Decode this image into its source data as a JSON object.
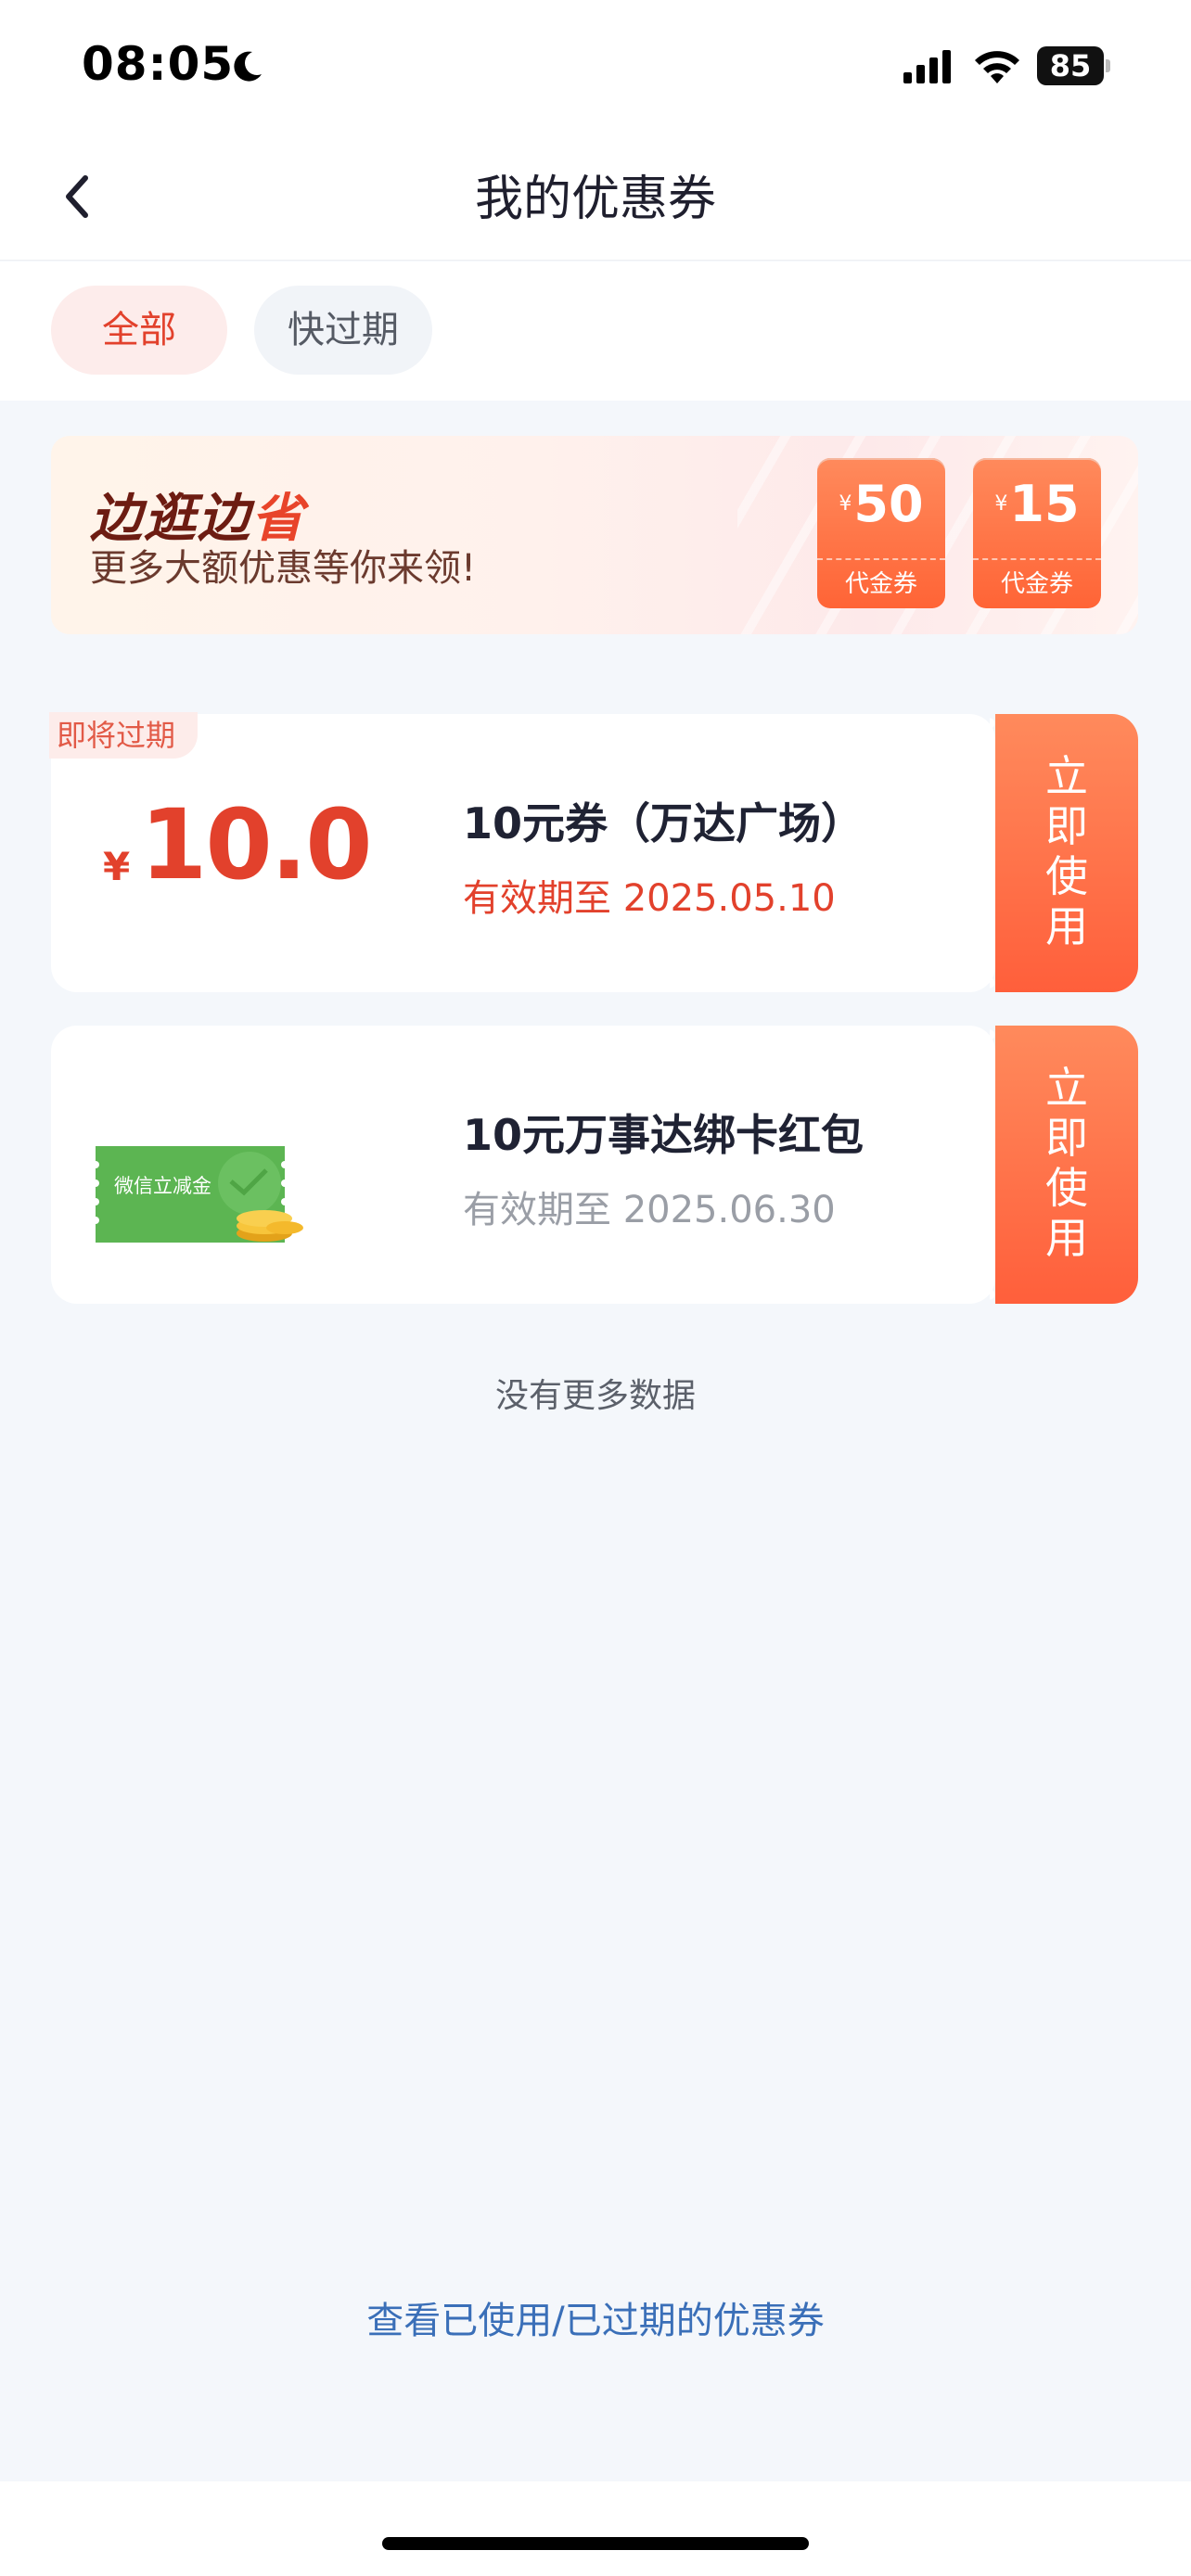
{
  "status_bar": {
    "time": "08:05",
    "battery": "85"
  },
  "nav": {
    "title": "我的优惠券"
  },
  "filters": [
    {
      "label": "全部",
      "active": true
    },
    {
      "label": "快过期",
      "active": false
    }
  ],
  "banner": {
    "title_part1": "边逛边",
    "title_part2": "省",
    "subtitle": "更多大额优惠等你来领!",
    "vouchers": [
      {
        "currency": "¥",
        "amount": "50",
        "label": "代金券"
      },
      {
        "currency": "¥",
        "amount": "15",
        "label": "代金券"
      }
    ]
  },
  "coupons": [
    {
      "badge": "即将过期",
      "currency": "¥",
      "amount": "10.0",
      "title": "10元券（万达广场）",
      "valid": "有效期至 2025.05.10",
      "action": [
        "立",
        "即",
        "使",
        "用"
      ]
    },
    {
      "image_text": "微信立减金",
      "title": "10元万事达绑卡红包",
      "valid": "有效期至 2025.06.30",
      "action": [
        "立",
        "即",
        "使",
        "用"
      ]
    }
  ],
  "footer": {
    "no_more": "没有更多数据",
    "history_link": "查看已使用/已过期的优惠券"
  },
  "colors": {
    "accent": "#e2412c",
    "action_gradient_top": "#ff8a5c",
    "action_gradient_bottom": "#ff5f3b",
    "link": "#3a6fb8",
    "background": "#f4f7fb"
  },
  "icons": [
    "moon-icon",
    "signal-icon",
    "wifi-icon",
    "battery-icon",
    "back-chevron-icon",
    "wechat-coupon-image"
  ]
}
